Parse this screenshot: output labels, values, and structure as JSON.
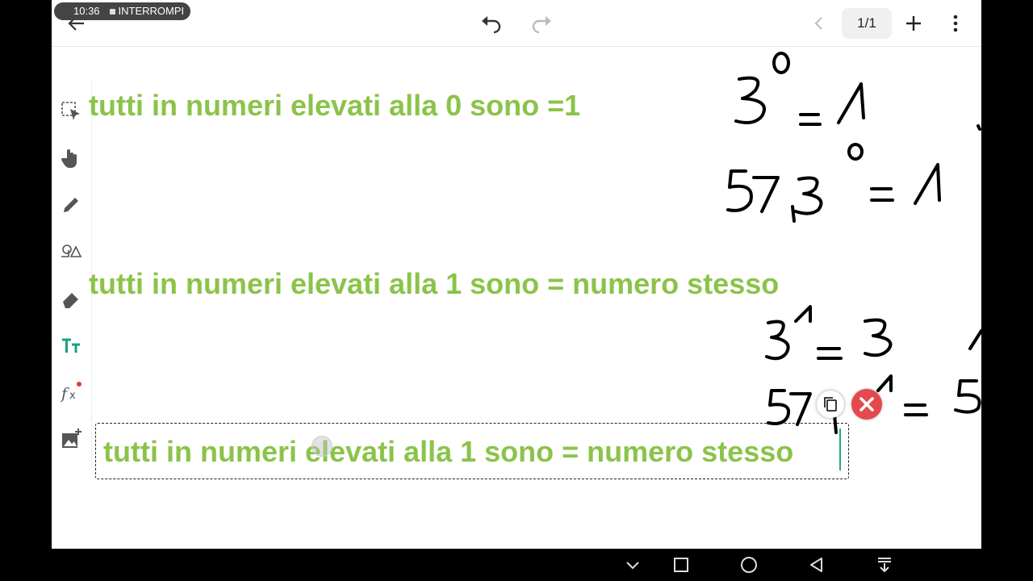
{
  "status": {
    "time": "10:36",
    "label": "INTERROMPI"
  },
  "header": {
    "page_indicator": "1/1"
  },
  "toolbar": {
    "tools": [
      "select-tool",
      "hand-tool",
      "pen-tool",
      "shapes-tool",
      "eraser-tool",
      "text-tool",
      "formula-tool",
      "image-tool"
    ]
  },
  "canvas": {
    "rule_zero": "tutti in numeri elevati alla 0 sono =1",
    "rule_one": "tutti in numeri elevati alla 1 sono = numero stesso",
    "rule_one_editing": "tutti in numeri elevati alla 1 sono = numero stesso"
  },
  "colors": {
    "text_green": "#8bc34a",
    "close_red": "#e5484d",
    "accent_teal": "#1aa07a"
  }
}
